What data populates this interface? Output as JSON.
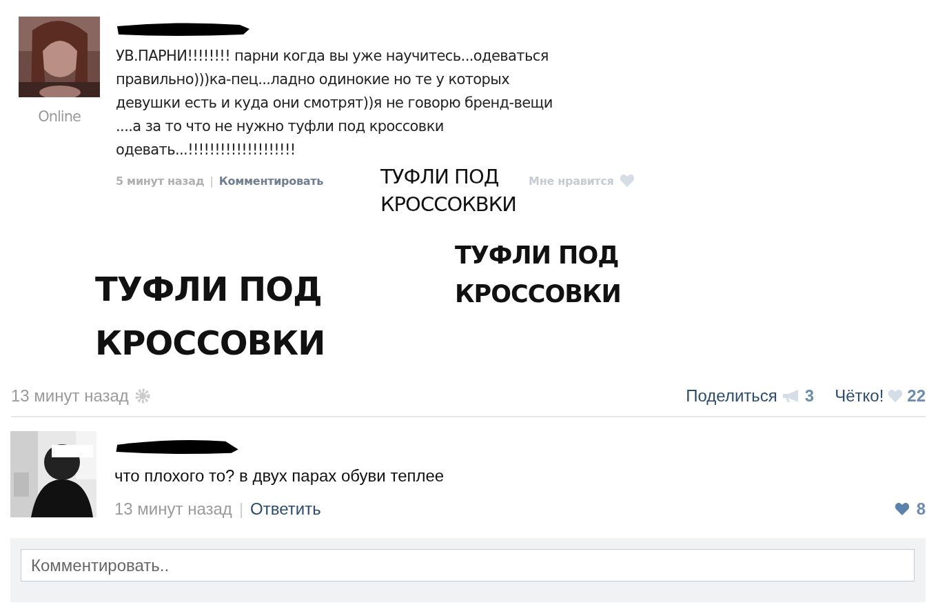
{
  "embedded_post": {
    "status": "Online",
    "text": "УВ.ПАРНИ!!!!!!!! парни когда вы уже научитесь...одеваться\nправильно)))ка-пец...ладно одинокие но те у которых\nдевушки есть и куда они смотрят))я не говорю бренд-вещи\n....а за то что не нужно туфли под кроссовки\nодевать...!!!!!!!!!!!!!!!!!!!!",
    "time": "5 минут назад",
    "separator": "|",
    "comment_link": "Комментировать",
    "like_label": "Мне нравится",
    "liked": false
  },
  "captions": [
    {
      "kind": "small",
      "lines": [
        "ТУФЛИ ПОД",
        "КРОССОКВКИ"
      ]
    },
    {
      "kind": "medium",
      "lines": [
        "ТУФЛИ ПОД",
        "КРОССОВКИ"
      ]
    },
    {
      "kind": "large",
      "lines": [
        "ТУФЛИ ПОД",
        "КРОССОВКИ"
      ]
    }
  ],
  "post_footer": {
    "time": "13 минут назад",
    "share_label": "Поделиться",
    "share_count": "3",
    "like_label": "Чётко!",
    "like_count": "22",
    "liked": false
  },
  "comment": {
    "text": "что плохого то? в двух парах обуви теплее",
    "time": "13 минут назад",
    "separator": "|",
    "reply_link": "Ответить",
    "like_count": "8",
    "liked": true
  },
  "comment_field": {
    "placeholder": "Комментировать.."
  }
}
